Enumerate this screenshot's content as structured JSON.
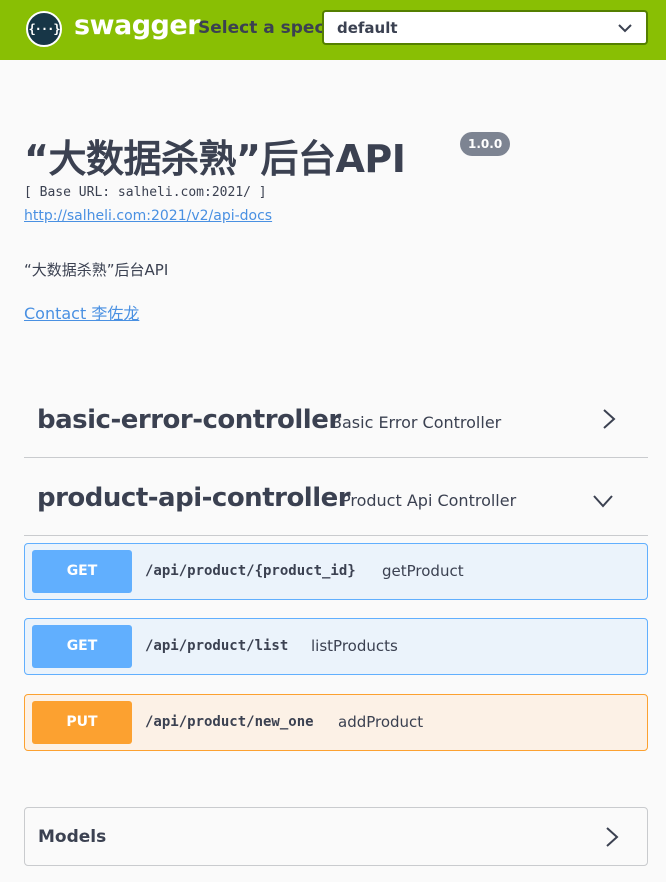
{
  "topbar": {
    "logo_glyph": "{···}",
    "brand": "swagger",
    "select_label": "Select a spec",
    "selected_spec": "default"
  },
  "info": {
    "title": "“大数据杀熟”后台API",
    "version": "1.0.0",
    "base_url": "[ Base URL: salheli.com:2021/ ]",
    "docs_url": "http://salheli.com:2021/v2/api-docs",
    "description": "“大数据杀熟”后台API",
    "contact": "Contact 李佐龙"
  },
  "tags": [
    {
      "name": "basic-error-controller",
      "description": "Basic Error Controller",
      "expanded": false
    },
    {
      "name": "product-api-controller",
      "description": "Product Api Controller",
      "expanded": true,
      "operations": [
        {
          "method": "GET",
          "path": "/api/product/{product_id}",
          "summary": "getProduct"
        },
        {
          "method": "GET",
          "path": "/api/product/list",
          "summary": "listProducts"
        },
        {
          "method": "PUT",
          "path": "/api/product/new_one",
          "summary": "addProduct"
        }
      ]
    }
  ],
  "models": {
    "label": "Models"
  },
  "colors": {
    "topbar": "#89bf04",
    "get": "#61affe",
    "put": "#fca130",
    "link": "#4990e2",
    "text": "#3b4151"
  }
}
